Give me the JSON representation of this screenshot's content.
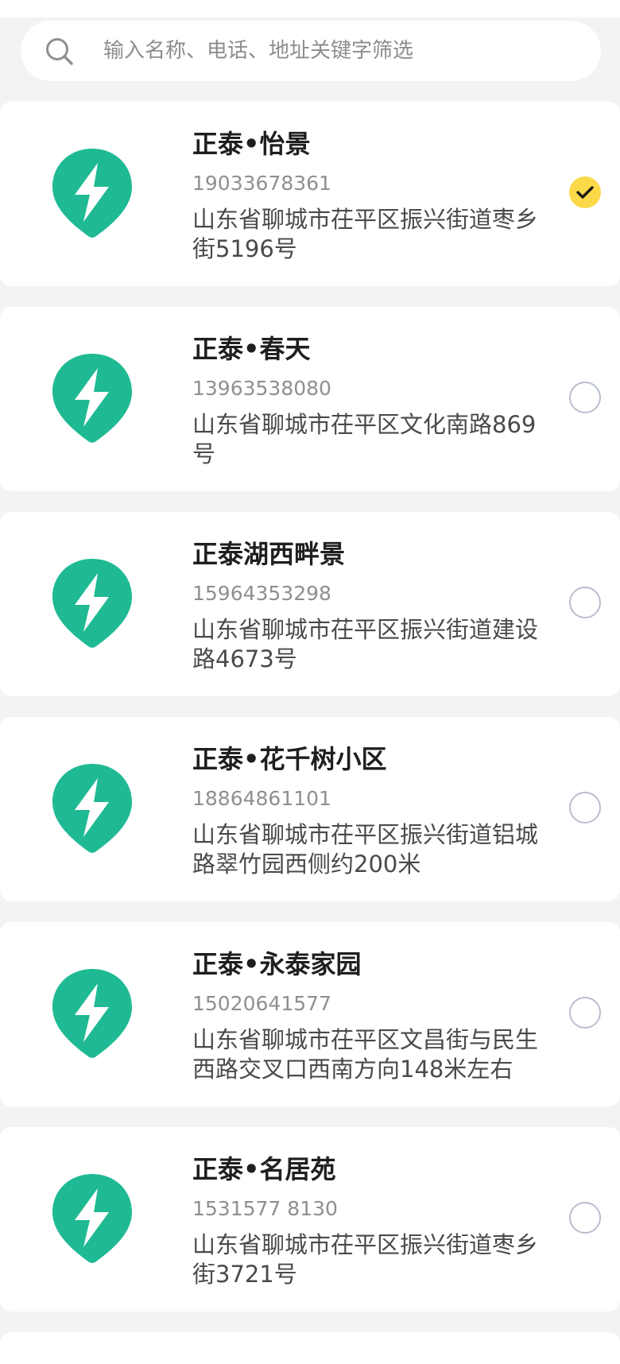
{
  "search": {
    "placeholder": "输入名称、电话、地址关键字筛选",
    "icon": "search-icon"
  },
  "colors": {
    "accent": "#1fba94",
    "selected": "#fbd948",
    "background": "#f3f3f3"
  },
  "stations": [
    {
      "name": "正泰•怡景",
      "phone": "19033678361",
      "address": "山东省聊城市茌平区振兴街道枣乡街5196号",
      "selected": true,
      "icon": "charging-station-icon"
    },
    {
      "name": "正泰•春天",
      "phone": "13963538080",
      "address": "山东省聊城市茌平区文化南路869号",
      "selected": false,
      "icon": "charging-station-icon"
    },
    {
      "name": "正泰湖西畔景",
      "phone": "15964353298",
      "address": "山东省聊城市茌平区振兴街道建设路4673号",
      "selected": false,
      "icon": "charging-station-icon"
    },
    {
      "name": "正泰•花千树小区",
      "phone": "18864861101",
      "address": "山东省聊城市茌平区振兴街道铝城路翠竹园西侧约200米",
      "selected": false,
      "icon": "charging-station-icon"
    },
    {
      "name": "正泰•永泰家园",
      "phone": "15020641577",
      "address": "山东省聊城市茌平区文昌街与民生西路交叉口西南方向148米左右",
      "selected": false,
      "icon": "charging-station-icon"
    },
    {
      "name": "正泰•名居苑",
      "phone": "1531577 8130",
      "address": "山东省聊城市茌平区振兴街道枣乡街3721号",
      "selected": false,
      "icon": "charging-station-icon"
    }
  ]
}
